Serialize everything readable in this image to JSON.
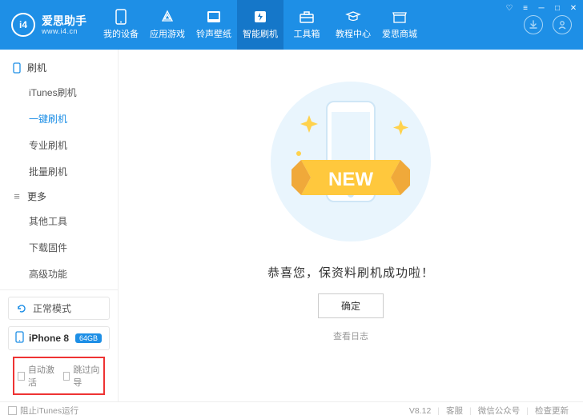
{
  "brand": {
    "logo_text": "i4",
    "title": "爱思助手",
    "subtitle": "www.i4.cn"
  },
  "topnav": {
    "items": [
      {
        "label": "我的设备"
      },
      {
        "label": "应用游戏"
      },
      {
        "label": "铃声壁纸"
      },
      {
        "label": "智能刷机"
      },
      {
        "label": "工具箱"
      },
      {
        "label": "教程中心"
      },
      {
        "label": "爱思商城"
      }
    ],
    "active_index": 3
  },
  "sidebar": {
    "group1_label": "刷机",
    "group1_items": [
      "iTunes刷机",
      "一键刷机",
      "专业刷机",
      "批量刷机"
    ],
    "group1_active_index": 1,
    "group2_label": "更多",
    "group2_items": [
      "其他工具",
      "下载固件",
      "高级功能"
    ],
    "mode_label": "正常模式",
    "device_name": "iPhone 8",
    "device_badge": "64GB",
    "check_auto_activate": "自动激活",
    "check_skip_guide": "跳过向导"
  },
  "main": {
    "new_ribbon": "NEW",
    "success": "恭喜您，保资料刷机成功啦！",
    "ok": "确定",
    "log": "查看日志"
  },
  "footer": {
    "block_itunes": "阻止iTunes运行",
    "version": "V8.12",
    "service": "客服",
    "wechat": "微信公众号",
    "update": "检查更新"
  }
}
